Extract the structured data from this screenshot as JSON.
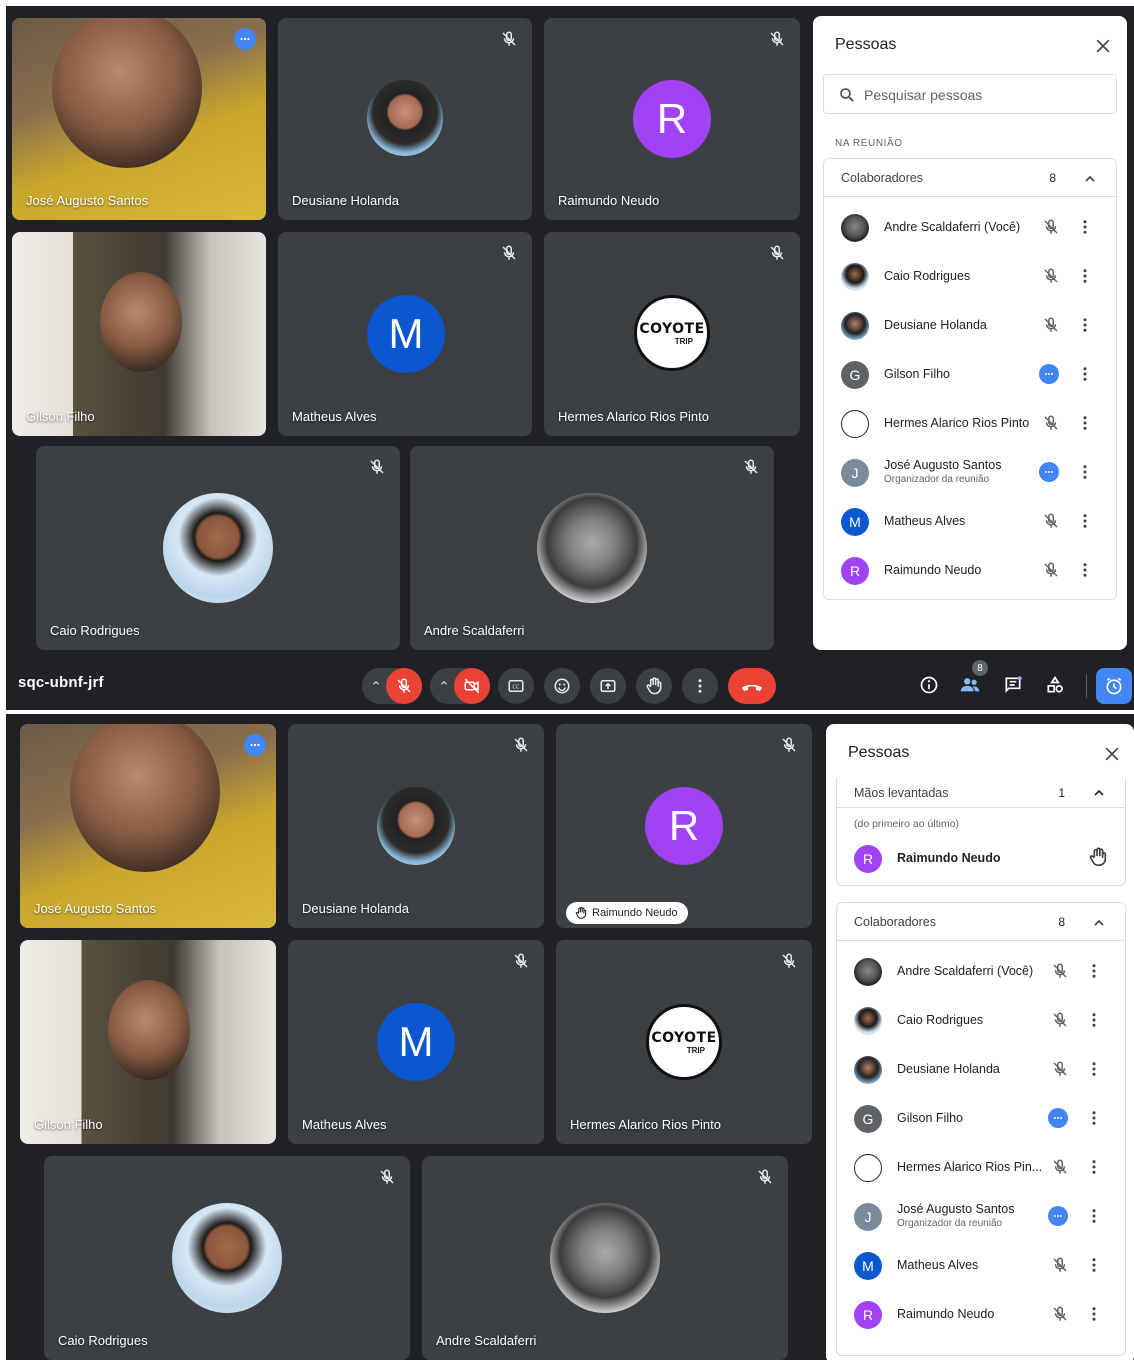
{
  "meeting": {
    "code": "sqc-ubnf-jrf",
    "people_count": "8"
  },
  "participants": {
    "jose": "José Augusto Santos",
    "deusiane": "Deusiane Holanda",
    "raimundo": "Raimundo Neudo",
    "gilson": "Gilson Filho",
    "matheus": "Matheus Alves",
    "hermes": "Hermes Alarico Rios Pinto",
    "caio": "Caio Rodrigues",
    "andre": "Andre Scaldaferri"
  },
  "avatars": {
    "raimundo_letter": "R",
    "matheus_letter": "M",
    "coyote_text": "COYOTE",
    "coyote_sub": "TRIP"
  },
  "panel": {
    "title": "Pessoas",
    "search_placeholder": "Pesquisar pessoas",
    "section_label": "NA REUNIÃO",
    "collab_group": "Colaboradores",
    "collab_count": "8",
    "raised_group": "Mãos levantadas",
    "raised_count": "1",
    "raised_hint": "(do primeiro ao último)",
    "raised_name": "Raimundo Neudo",
    "list": [
      {
        "name": "Andre Scaldaferri (Você)",
        "avatar": "photo-a",
        "status": "mic-off"
      },
      {
        "name": "Caio Rodrigues",
        "avatar": "photo-c",
        "status": "mic-off"
      },
      {
        "name": "Deusiane Holanda",
        "avatar": "photo-d",
        "status": "mic-off"
      },
      {
        "name": "Gilson Filho",
        "avatar": "G",
        "status": "more"
      },
      {
        "name": "Hermes Alarico Rios Pinto",
        "avatar": "coyote",
        "status": "mic-off"
      },
      {
        "name": "José Augusto Santos",
        "sub": "Organizador da reunião",
        "avatar": "J",
        "status": "more"
      },
      {
        "name": "Matheus Alves",
        "avatar": "M",
        "status": "mic-off"
      },
      {
        "name": "Raimundo Neudo",
        "avatar": "R",
        "status": "mic-off"
      }
    ],
    "hermes_truncated": "Hermes Alarico Rios Pin...",
    "avatar_letters": {
      "g": "G",
      "j": "J",
      "m": "M",
      "r": "R"
    },
    "coyote_mini": "COYOTE"
  },
  "hand_pill": "Raimundo Neudo",
  "colors": {
    "background": "#202124",
    "tile": "#3c4043",
    "accent": "#4285f4",
    "danger": "#ea4335",
    "active_outline": "#8ab4f8"
  },
  "icons": [
    "mic-off-icon",
    "more-icon",
    "search-icon",
    "close-icon",
    "chevron-up-icon",
    "kebab-icon",
    "hand-icon",
    "captions-icon",
    "emoji-icon",
    "present-icon",
    "camera-off-icon",
    "hangup-icon",
    "info-icon",
    "people-icon",
    "chat-icon",
    "activities-icon",
    "clock-icon"
  ]
}
